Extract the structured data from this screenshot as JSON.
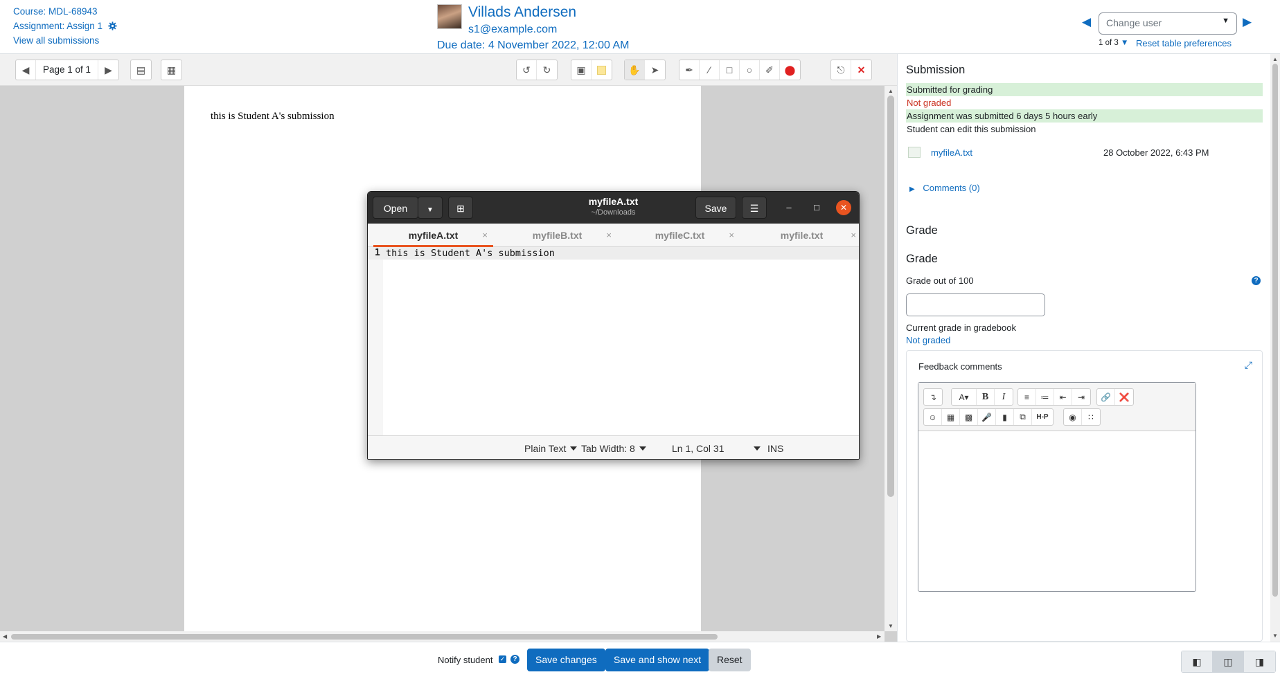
{
  "header": {
    "course_link": "Course: MDL-68943",
    "assignment_link": "Assignment: Assign 1",
    "view_all": "View all submissions",
    "user_name": "Villads Andersen",
    "user_email": "s1@example.com",
    "due_date": "Due date: 4 November 2022, 12:00 AM",
    "change_user_placeholder": "Change user",
    "user_count": "1 of 3",
    "reset_prefs": "Reset table preferences"
  },
  "pdf_toolbar": {
    "page_label": "Page 1 of 1"
  },
  "pdf": {
    "page_text": "this is Student A's submission"
  },
  "submission": {
    "heading": "Submission",
    "status_submitted": "Submitted for grading",
    "status_graded": "Not graded",
    "status_early": "Assignment was submitted 6 days 5 hours early",
    "status_edit": "Student can edit this submission",
    "file_name": "myfileA.txt",
    "file_date": "28 October 2022, 6:43 PM",
    "comments_link": "Comments (0)"
  },
  "grade": {
    "heading_1": "Grade",
    "heading_2": "Grade",
    "grade_label": "Grade out of 100",
    "grade_value": "",
    "current_label": "Current grade in gradebook",
    "current_value": "Not graded",
    "feedback_label": "Feedback comments"
  },
  "bottom": {
    "notify_label": "Notify student",
    "save_changes": "Save changes",
    "save_next": "Save and show next",
    "reset": "Reset"
  },
  "gedit": {
    "open_label": "Open",
    "save_label": "Save",
    "title": "myfileA.txt",
    "subtitle": "~/Downloads",
    "tabs": [
      {
        "label": "myfileA.txt"
      },
      {
        "label": "myfileB.txt"
      },
      {
        "label": "myfileC.txt"
      },
      {
        "label": "myfile.txt"
      }
    ],
    "line_number": "1",
    "line_text": "this is Student A's submission",
    "status_syntax": "Plain Text",
    "status_tabwidth": "Tab Width: 8",
    "status_position": "Ln 1, Col 31",
    "status_mode": "INS"
  },
  "colors": {
    "accent": "#0f6cbf",
    "success_bg": "#d7f0d8",
    "danger": "#ca3120",
    "gedit_orange": "#e95420",
    "gedit_header": "#2d2d2d"
  }
}
